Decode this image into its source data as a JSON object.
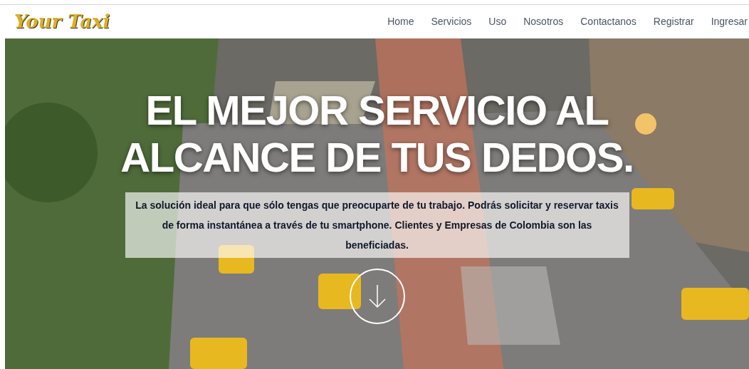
{
  "header": {
    "logo": "Your Taxi",
    "nav": [
      {
        "label": "Home"
      },
      {
        "label": "Servicios"
      },
      {
        "label": "Uso"
      },
      {
        "label": "Nosotros"
      },
      {
        "label": "Contactanos"
      },
      {
        "label": "Registrar"
      },
      {
        "label": "Ingresar"
      }
    ]
  },
  "hero": {
    "headline": [
      "EL MEJOR SERVICIO AL",
      "ALCANCE DE TUS DEDOS."
    ],
    "description": "La solución ideal para que sólo tengas que preocuparte de tu trabajo. Podrás solicitar y reservar taxis de forma instantánea a través de tu smartphone. Clientes y Empresas de Colombia son las beneficiadas."
  }
}
